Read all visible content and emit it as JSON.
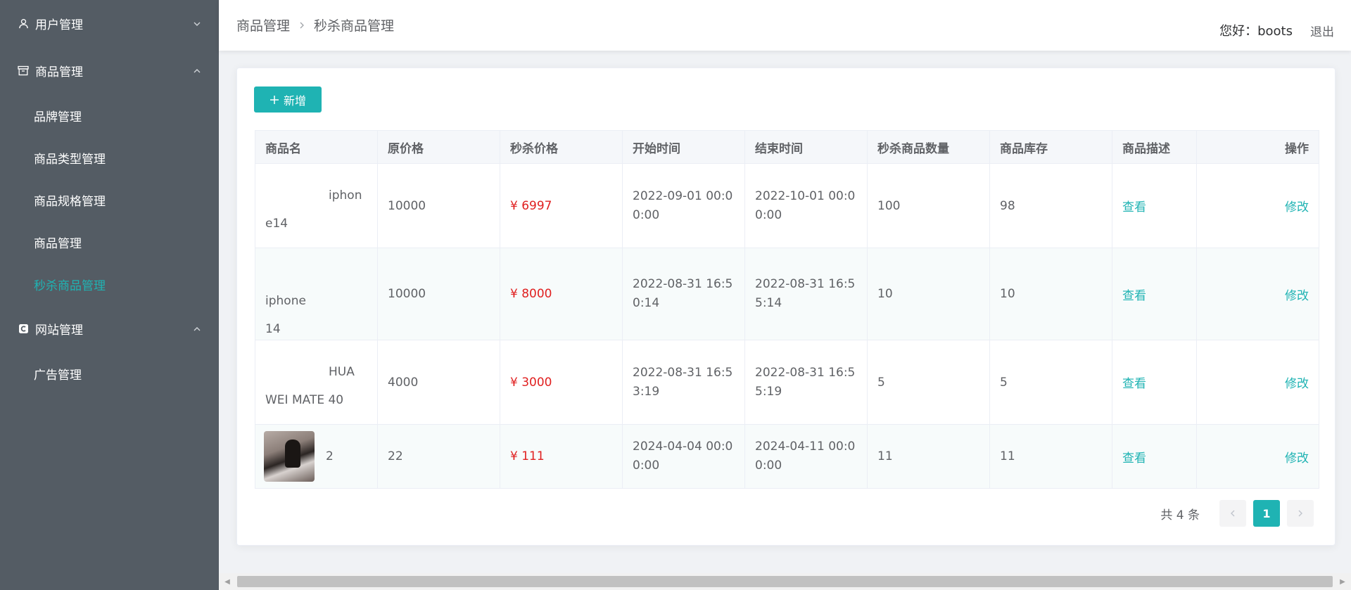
{
  "sidebar": {
    "groups": [
      {
        "label": "用户管理",
        "icon": "user-icon",
        "expanded": false,
        "items": []
      },
      {
        "label": "商品管理",
        "icon": "archive-icon",
        "expanded": true,
        "items": [
          "品牌管理",
          "商品类型管理",
          "商品规格管理",
          "商品管理",
          "秒杀商品管理"
        ]
      },
      {
        "label": "网站管理",
        "icon": "site-icon",
        "expanded": true,
        "items": [
          "广告管理"
        ]
      }
    ],
    "active_item": "秒杀商品管理",
    "colors": {
      "background": "#545c64",
      "active": "#1fb3b3"
    }
  },
  "header": {
    "breadcrumb": [
      "商品管理",
      "秒杀商品管理"
    ],
    "greeting": "您好：boots",
    "logout": "退出"
  },
  "toolbar": {
    "add_label": "新增"
  },
  "table": {
    "columns": [
      "商品名",
      "原价格",
      "秒杀价格",
      "开始时间",
      "结束时间",
      "秒杀商品数量",
      "商品库存",
      "商品描述",
      "操作"
    ],
    "rows": [
      {
        "name_a": "iphon",
        "name_b": "e14",
        "price": "10000",
        "seckill_price": "¥ 6997",
        "start_a": "2022-09-01 00:0",
        "start_b": "0:00",
        "end_a": "2022-10-01 00:0",
        "end_b": "0:00",
        "count": "100",
        "stock": "98",
        "desc": "查看",
        "op": "修改"
      },
      {
        "name_a": "iphone",
        "name_b": "14",
        "price": "10000",
        "seckill_price": "¥ 8000",
        "start_a": "2022-08-31 16:5",
        "start_b": "0:14",
        "end_a": "2022-08-31 16:5",
        "end_b": "5:14",
        "count": "10",
        "stock": "10",
        "desc": "查看",
        "op": "修改"
      },
      {
        "name_a": "HUA",
        "name_b": "WEI MATE 40",
        "price": "4000",
        "seckill_price": "¥ 3000",
        "start_a": "2022-08-31 16:5",
        "start_b": "3:19",
        "end_a": "2022-08-31 16:5",
        "end_b": "5:19",
        "count": "5",
        "stock": "5",
        "desc": "查看",
        "op": "修改"
      },
      {
        "name_a": "2",
        "name_b": "",
        "price": "22",
        "seckill_price": "¥ 111",
        "start_a": "2024-04-04 00:0",
        "start_b": "0:00",
        "end_a": "2024-04-11 00:0",
        "end_b": "0:00",
        "count": "11",
        "stock": "11",
        "desc": "查看",
        "op": "修改"
      }
    ]
  },
  "pagination": {
    "total": "共 4 条",
    "current": "1"
  }
}
